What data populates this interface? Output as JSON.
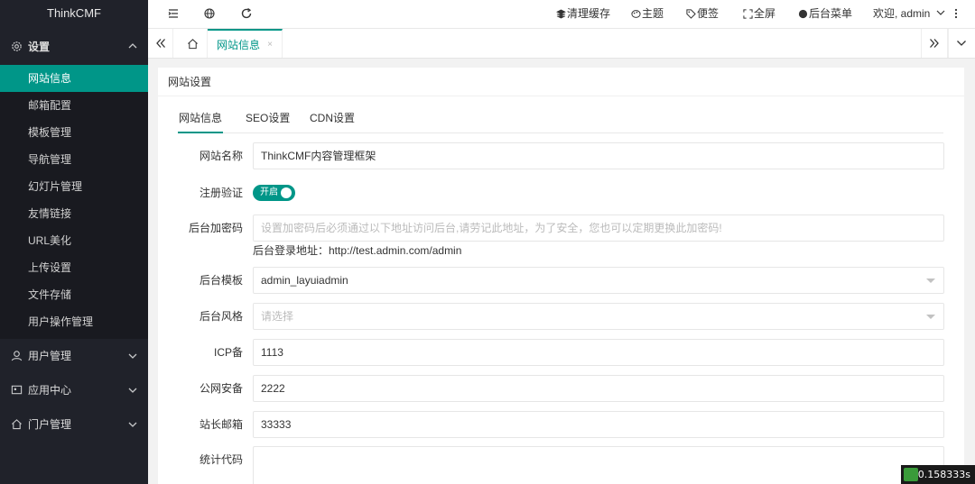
{
  "app": {
    "logo": "ThinkCMF"
  },
  "sidebar": {
    "settings_group": "设置",
    "items": [
      {
        "label": "网站信息",
        "active": true
      },
      {
        "label": "邮箱配置"
      },
      {
        "label": "模板管理"
      },
      {
        "label": "导航管理"
      },
      {
        "label": "幻灯片管理"
      },
      {
        "label": "友情链接"
      },
      {
        "label": "URL美化"
      },
      {
        "label": "上传设置"
      },
      {
        "label": "文件存储"
      },
      {
        "label": "用户操作管理"
      }
    ],
    "groups": [
      {
        "label": "用户管理",
        "icon": "user-icon"
      },
      {
        "label": "应用中心",
        "icon": "app-icon"
      },
      {
        "label": "门户管理",
        "icon": "home-icon"
      }
    ]
  },
  "header": {
    "clear_cache": "清理缓存",
    "theme": "主题",
    "notes": "便签",
    "fullscreen": "全屏",
    "backend_menu": "后台菜单",
    "welcome": "欢迎, admin"
  },
  "tabs": {
    "active_tab": "网站信息",
    "close": "×"
  },
  "card": {
    "title": "网站设置",
    "subtabs": [
      "网站信息",
      "SEO设置",
      "CDN设置"
    ]
  },
  "form": {
    "site_name": {
      "label": "网站名称",
      "value": "ThinkCMF内容管理框架"
    },
    "captcha": {
      "label": "注册验证",
      "switch_text": "开启",
      "on": true
    },
    "admin_password": {
      "label": "后台加密码",
      "placeholder": "设置加密码后必须通过以下地址访问后台,请劳记此地址，为了安全，您也可以定期更换此加密码!",
      "hint": "后台登录地址：http://test.admin.com/admin"
    },
    "admin_theme": {
      "label": "后台模板",
      "value": "admin_layuiadmin"
    },
    "admin_style": {
      "label": "后台风格",
      "placeholder": "请选择"
    },
    "icp": {
      "label": "ICP备",
      "value": "1113"
    },
    "police": {
      "label": "公网安备",
      "value": "2222"
    },
    "email": {
      "label": "站长邮箱",
      "value": "33333"
    },
    "stat_code": {
      "label": "统计代码",
      "value": ""
    }
  },
  "debug": {
    "time": "0.158333s"
  },
  "colors": {
    "accent": "#009688",
    "sidebar_bg": "#20222a"
  }
}
